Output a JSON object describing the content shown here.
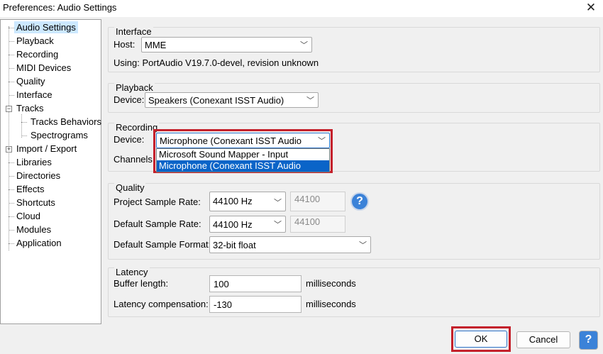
{
  "window": {
    "title": "Preferences: Audio Settings",
    "close_glyph": "✕"
  },
  "tree": {
    "items": [
      {
        "label": "Audio Settings",
        "selected": true
      },
      {
        "label": "Playback"
      },
      {
        "label": "Recording"
      },
      {
        "label": "MIDI Devices"
      },
      {
        "label": "Quality"
      },
      {
        "label": "Interface"
      },
      {
        "label": "Tracks",
        "expander": "−"
      },
      {
        "label": "Tracks Behaviors"
      },
      {
        "label": "Spectrograms"
      },
      {
        "label": "Import / Export",
        "expander": "+"
      },
      {
        "label": "Libraries"
      },
      {
        "label": "Directories"
      },
      {
        "label": "Effects"
      },
      {
        "label": "Shortcuts"
      },
      {
        "label": "Cloud"
      },
      {
        "label": "Modules"
      },
      {
        "label": "Application"
      }
    ]
  },
  "interface": {
    "title": "Interface",
    "host_label": "Host:",
    "host_value": "MME",
    "using_text": "Using: PortAudio V19.7.0-devel, revision unknown"
  },
  "playback": {
    "title": "Playback",
    "device_label": "Device:",
    "device_value": "Speakers (Conexant ISST Audio)"
  },
  "recording": {
    "title": "Recording",
    "device_label": "Device:",
    "device_value": "Microphone (Conexant ISST Audio",
    "channels_label": "Channels:",
    "options": [
      "Microsoft Sound Mapper - Input",
      "Microphone (Conexant ISST Audio"
    ]
  },
  "quality": {
    "title": "Quality",
    "project_rate_label": "Project Sample Rate:",
    "project_rate_value": "44100 Hz",
    "project_rate_text": "44100",
    "default_rate_label": "Default Sample Rate:",
    "default_rate_value": "44100 Hz",
    "default_rate_text": "44100",
    "format_label": "Default Sample Format:",
    "format_value": "32-bit float",
    "help_glyph": "?"
  },
  "latency": {
    "title": "Latency",
    "buffer_label": "Buffer length:",
    "buffer_value": "100",
    "buffer_unit": "milliseconds",
    "comp_label": "Latency compensation:",
    "comp_value": "-130",
    "comp_unit": "milliseconds"
  },
  "buttons": {
    "ok": "OK",
    "cancel": "Cancel",
    "help_glyph": "?"
  },
  "colors": {
    "highlight": "#c4202b",
    "selection": "#0a64c8",
    "help": "#3b82d8"
  },
  "icons": {
    "chevron": "chevron-down-icon",
    "close": "close-icon",
    "help": "help-icon"
  }
}
